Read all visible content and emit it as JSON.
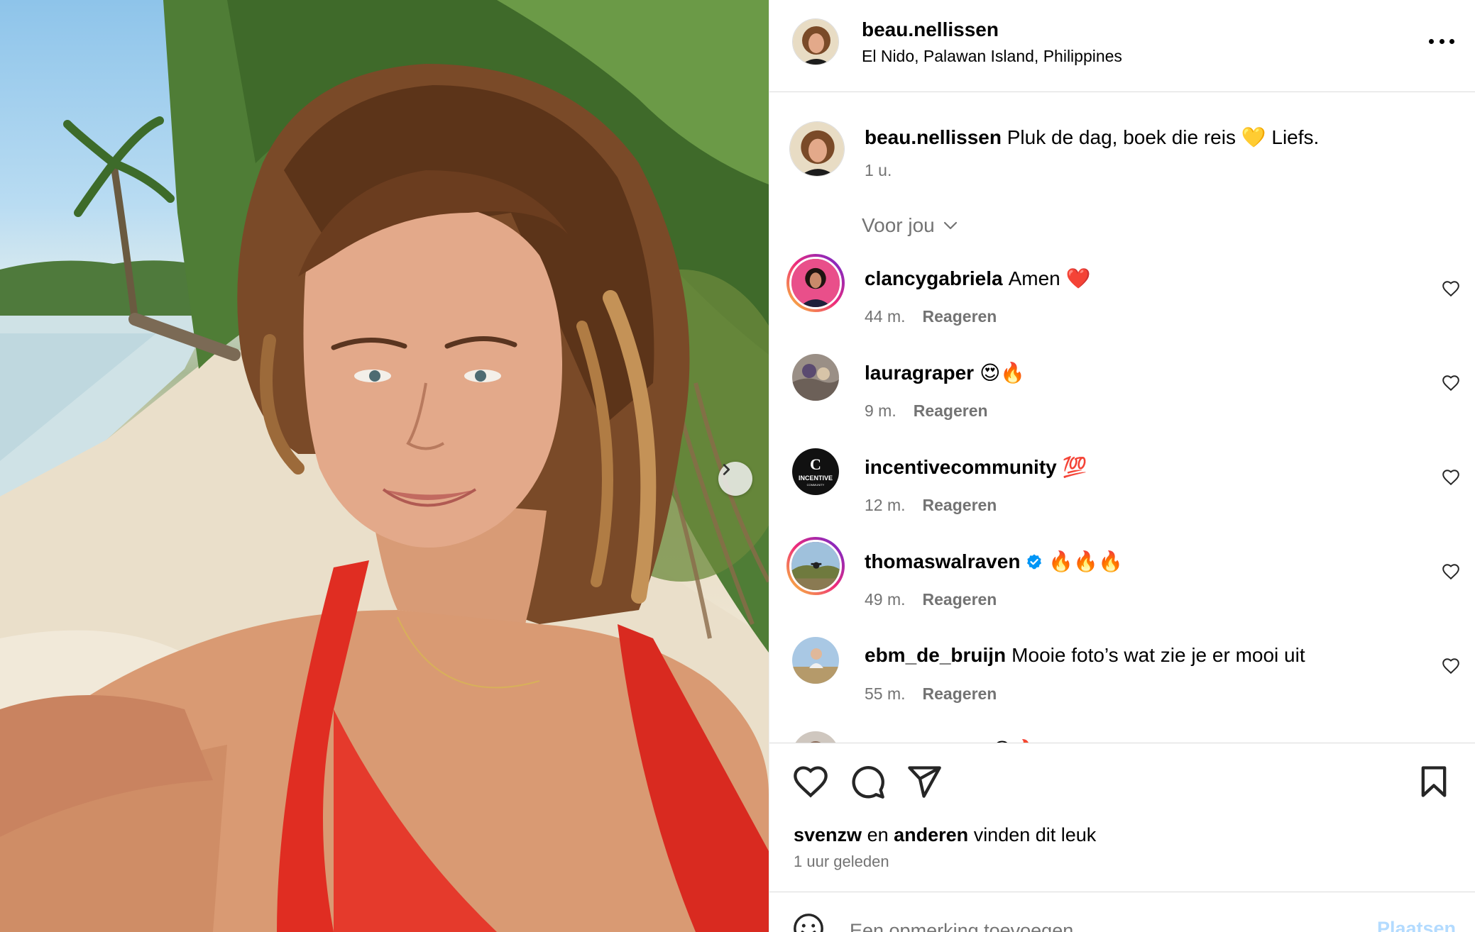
{
  "post": {
    "image_alt": "Selfie on a tropical beach",
    "next_icon": "chevron-right-icon"
  },
  "header": {
    "username": "beau.nellissen",
    "location": "El Nido, Palawan Island, Philippines",
    "more_icon": "more-horizontal-icon"
  },
  "caption": {
    "username": "beau.nellissen",
    "text": "Pluk de dag, boek die reis 💛 Liefs.",
    "time": "1 u."
  },
  "filter": {
    "label": "Voor jou"
  },
  "comments": [
    {
      "username": "clancygabriela",
      "text": "Amen ❤️",
      "time": "44 m.",
      "reply": "Reageren",
      "verified": false
    },
    {
      "username": "lauragraper",
      "text": "😍🔥",
      "time": "9 m.",
      "reply": "Reageren",
      "verified": false
    },
    {
      "username": "incentivecommunity",
      "text": "💯",
      "time": "12 m.",
      "reply": "Reageren",
      "verified": false
    },
    {
      "username": "thomaswalraven",
      "text": "🔥🔥🔥",
      "time": "49 m.",
      "reply": "Reageren",
      "verified": true
    },
    {
      "username": "ebm_de_bruijn",
      "text": "Mooie foto’s wat zie je er mooi uit",
      "time": "55 m.",
      "reply": "Reageren",
      "verified": false
    },
    {
      "username": "dustiegiallen",
      "text": "😍🔥",
      "time": "",
      "reply": "",
      "verified": false
    }
  ],
  "actions": {
    "like_icon": "heart-icon",
    "comment_icon": "comment-icon",
    "share_icon": "send-icon",
    "save_icon": "bookmark-icon"
  },
  "likes": {
    "user": "svenzw",
    "connector": "en",
    "others": "anderen",
    "suffix": "vinden dit leuk"
  },
  "posted": "1 uur geleden",
  "add_comment": {
    "placeholder": "Een opmerking toevoegen...",
    "post_label": "Plaatsen",
    "emoji_icon": "emoji-icon"
  },
  "colors": {
    "secondary_text": "#737373",
    "border": "#dbdbdb",
    "post_button_disabled": "#b3dbff",
    "verified": "#0095f6"
  }
}
